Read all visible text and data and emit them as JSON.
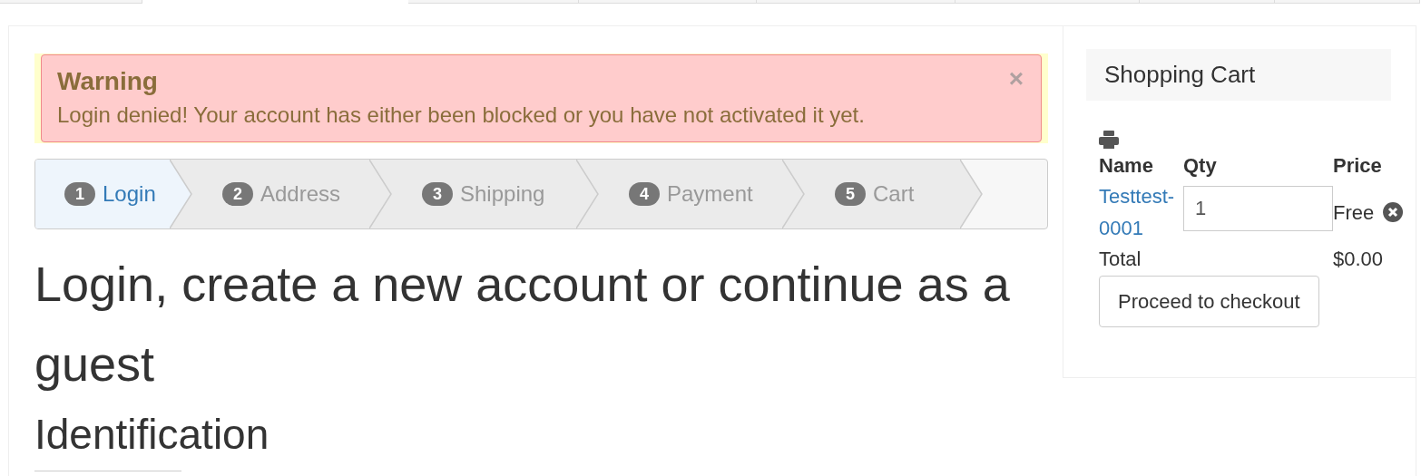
{
  "alert": {
    "title": "Warning",
    "message": "Login denied! Your account has either been blocked or you have not activated it yet.",
    "close": "×"
  },
  "steps": [
    {
      "number": "1",
      "label": "Login",
      "selected": true
    },
    {
      "number": "2",
      "label": "Address",
      "selected": false
    },
    {
      "number": "3",
      "label": "Shipping",
      "selected": false
    },
    {
      "number": "4",
      "label": "Payment",
      "selected": false
    },
    {
      "number": "5",
      "label": "Cart",
      "selected": false
    }
  ],
  "heading": "Login, create a new account or continue as a guest",
  "subheading": "Identification",
  "cart": {
    "title": "Shopping Cart",
    "columns": [
      "Name",
      "Qty",
      "Price"
    ],
    "items": [
      {
        "name": "Testtest-0001",
        "qty": "1",
        "price": "Free"
      }
    ],
    "total_label": "Total",
    "total": "$0.00",
    "checkout": "Proceed to checkout"
  }
}
